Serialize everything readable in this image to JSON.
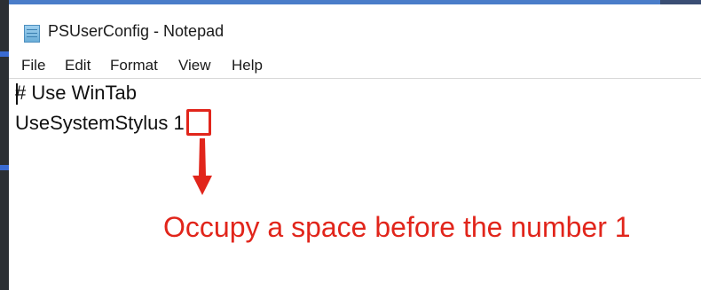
{
  "window": {
    "title": "PSUserConfig - Notepad"
  },
  "menu": {
    "items": [
      "File",
      "Edit",
      "Format",
      "View",
      "Help"
    ]
  },
  "editor": {
    "lines": [
      "# Use WinTab",
      "UseSystemStylus 1"
    ]
  },
  "annotation": {
    "text": "Occupy a space before the number 1",
    "color": "#e1251b"
  },
  "icons": {
    "app": "notepad-icon",
    "pointer": "arrow-down-icon"
  }
}
